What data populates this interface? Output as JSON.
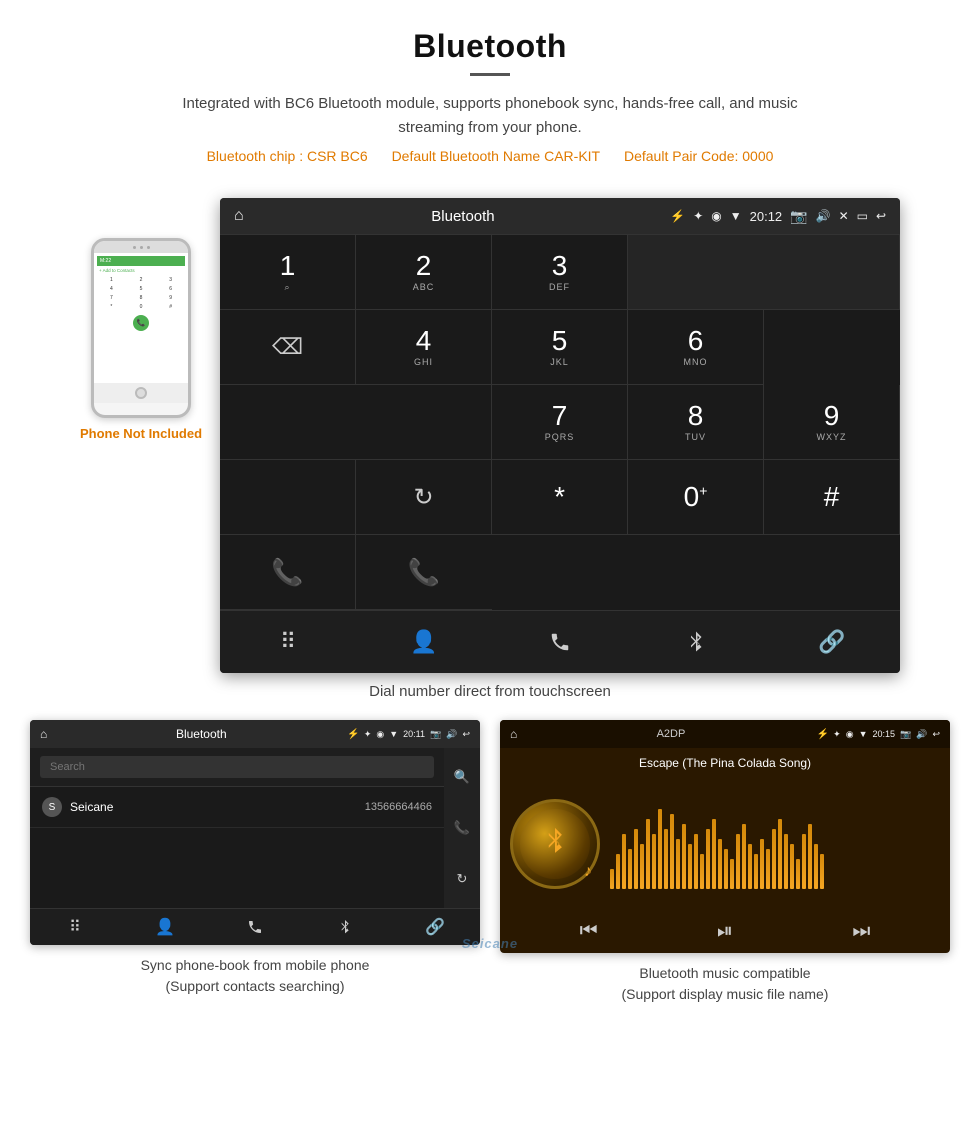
{
  "header": {
    "title": "Bluetooth",
    "description": "Integrated with BC6 Bluetooth module, supports phonebook sync, hands-free call, and music streaming from your phone.",
    "specs": {
      "chip": "Bluetooth chip : CSR BC6",
      "name": "Default Bluetooth Name CAR-KIT",
      "pair": "Default Pair Code: 0000"
    }
  },
  "main_screen": {
    "status_bar": {
      "title": "Bluetooth",
      "time": "20:12",
      "home_icon": "⌂",
      "usb_icon": "⚡",
      "bluetooth_icon": "✦",
      "location_icon": "◉",
      "wifi_icon": "▼",
      "camera_icon": "📷",
      "volume_icon": "🔊",
      "back_icon": "↩"
    },
    "dialpad": {
      "keys": [
        {
          "num": "1",
          "sub": "⌕"
        },
        {
          "num": "2",
          "sub": "ABC"
        },
        {
          "num": "3",
          "sub": "DEF"
        },
        {
          "num": "4",
          "sub": "GHI"
        },
        {
          "num": "5",
          "sub": "JKL"
        },
        {
          "num": "6",
          "sub": "MNO"
        },
        {
          "num": "7",
          "sub": "PQRS"
        },
        {
          "num": "8",
          "sub": "TUV"
        },
        {
          "num": "9",
          "sub": "WXYZ"
        },
        {
          "num": "*",
          "sub": ""
        },
        {
          "num": "0⁺",
          "sub": ""
        },
        {
          "num": "#",
          "sub": ""
        }
      ]
    },
    "bottom_icons": [
      "⠿",
      "👤",
      "📞",
      "✦",
      "🔗"
    ]
  },
  "main_label": "Dial number direct from touchscreen",
  "phone_mock": {
    "not_included_label": "Phone Not Included"
  },
  "phonebook_screen": {
    "title": "Bluetooth",
    "time": "20:11",
    "search_placeholder": "Search",
    "contacts": [
      {
        "letter": "S",
        "name": "Seicane",
        "number": "13566664466"
      }
    ],
    "bottom_caption": "Sync phone-book from mobile phone\n(Support contacts searching)"
  },
  "music_screen": {
    "status_bar_title": "A2DP",
    "time": "20:15",
    "song_title": "Escape (The Pina Colada Song)",
    "bottom_caption": "Bluetooth music compatible\n(Support display music file name)"
  },
  "watermark": "Seicane"
}
